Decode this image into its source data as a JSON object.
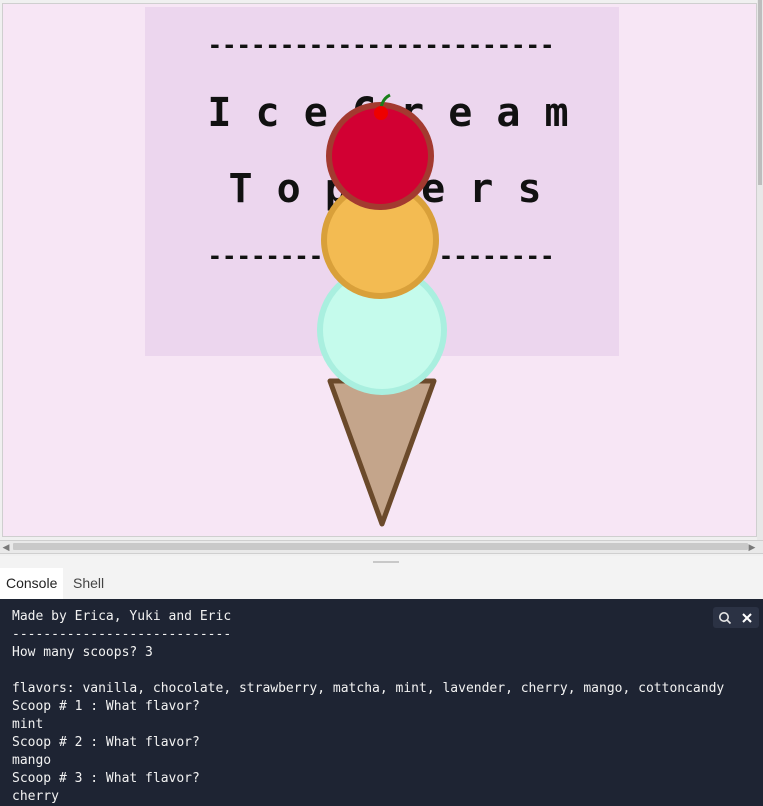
{
  "canvas": {
    "banner_line_top": "------------------------",
    "title_line1": "I c e   C r e a m",
    "title_line2": "T o   p p e r s",
    "banner_line_bottom": "------------------------",
    "colors": {
      "background": "#f7e6f5",
      "banner": "#ecd6ee",
      "cherry_scoop": "#d20033",
      "cherry_rim": "#a33a30",
      "mango_scoop": "#f3bb52",
      "mango_rim": "#d9a03a",
      "mint_scoop": "#c5fbec",
      "mint_rim": "#a9efdf",
      "cone_fill": "#c4a58b",
      "cone_outline": "#6b4a2b",
      "cherry": "#ee0000",
      "stem": "#1a7f1a"
    }
  },
  "tabs": [
    {
      "label": "Console",
      "active": true
    },
    {
      "label": "Shell",
      "active": false
    }
  ],
  "console": {
    "lines": [
      "Made by Erica, Yuki and Eric",
      "----------------------------",
      "How many scoops? 3",
      "",
      "flavors: vanilla, chocolate, strawberry, matcha, mint, lavender, cherry, mango, cottoncandy",
      "Scoop # 1 : What flavor?",
      "mint",
      "Scoop # 2 : What flavor?",
      "mango",
      "Scoop # 3 : What flavor?",
      "cherry"
    ],
    "tools": {
      "search_icon": "search-icon",
      "close_icon": "close-icon"
    }
  }
}
